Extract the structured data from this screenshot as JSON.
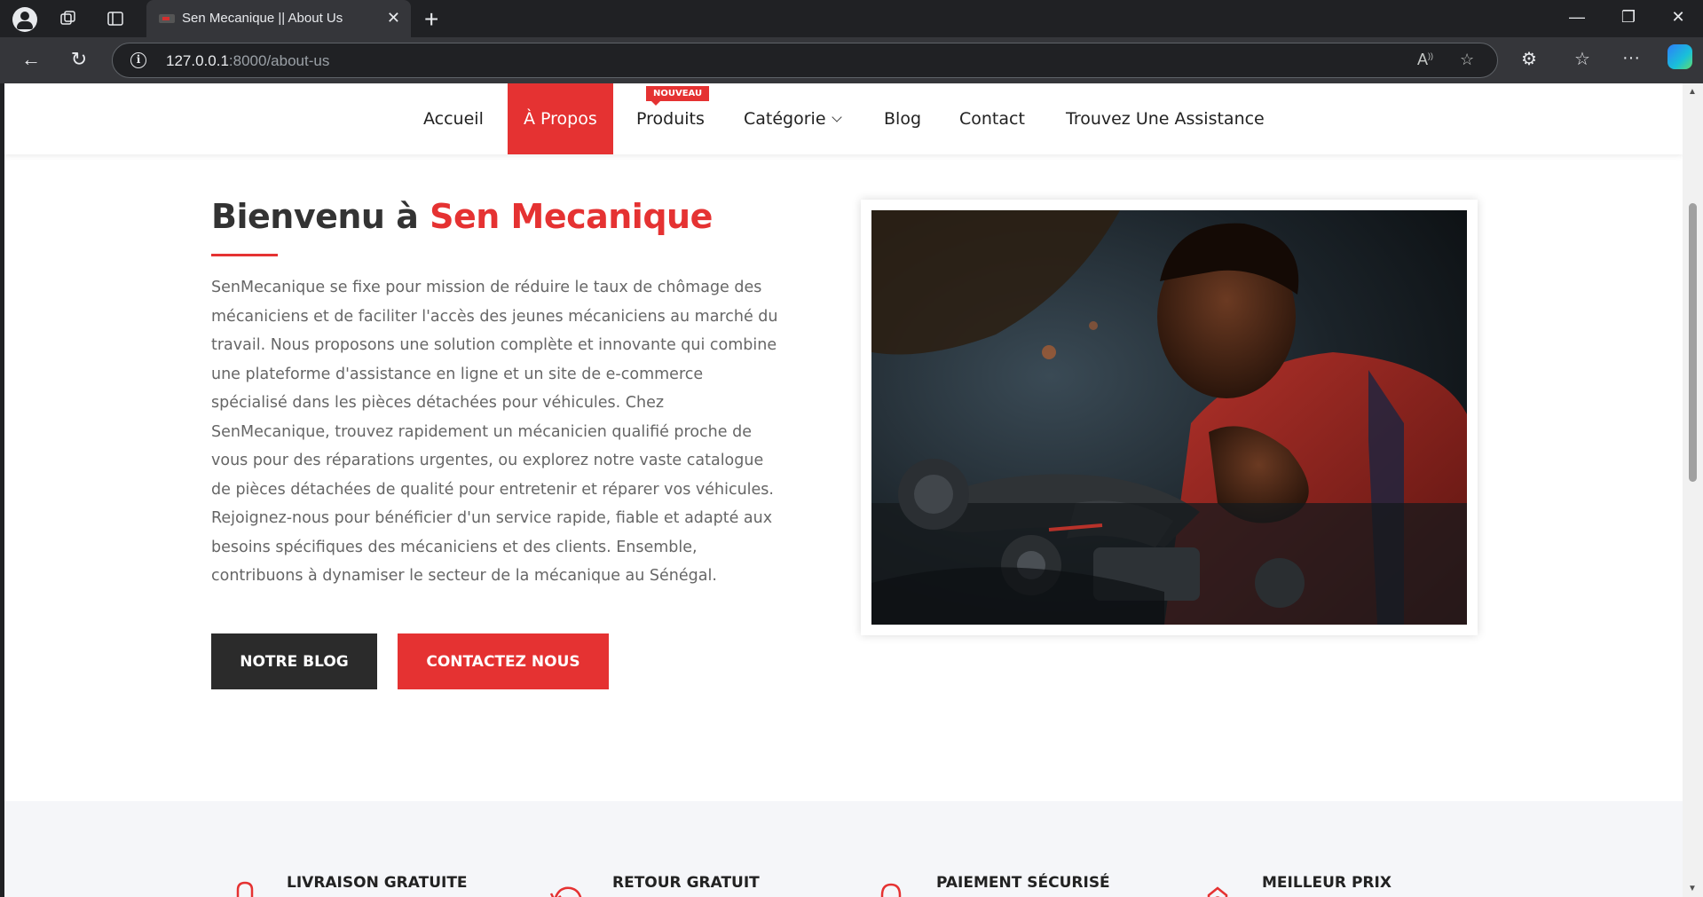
{
  "browser": {
    "tab_title": "Sen Mecanique || About Us",
    "url_host": "127.0.0.1",
    "url_path": ":8000/about-us"
  },
  "nav": {
    "items": [
      {
        "label": "Accueil"
      },
      {
        "label": "À Propos"
      },
      {
        "label": "Produits"
      },
      {
        "label": "Catégorie"
      },
      {
        "label": "Blog"
      },
      {
        "label": "Contact"
      },
      {
        "label": "Trouvez Une Assistance"
      }
    ],
    "active_index": 1,
    "badge": "NOUVEAU"
  },
  "about": {
    "title_prefix": "Bienvenu à ",
    "title_accent": "Sen Mecanique",
    "body": "SenMecanique se fixe pour mission de réduire le taux de chômage des mécaniciens et de faciliter l'accès des jeunes mécaniciens au marché du travail. Nous proposons une solution complète et innovante qui combine une plateforme d'assistance en ligne et un site de e-commerce spécialisé dans les pièces détachées pour véhicules. Chez SenMecanique, trouvez rapidement un mécanicien qualifié proche de vous pour des réparations urgentes, ou explorez notre vaste catalogue de pièces détachées de qualité pour entretenir et réparer vos véhicules. Rejoignez-nous pour bénéficier d'un service rapide, fiable et adapté aux besoins spécifiques des mécaniciens et des clients. Ensemble, contribuons à dynamiser le secteur de la mécanique au Sénégal.",
    "btn_blog": "NOTRE BLOG",
    "btn_contact": "CONTACTEZ NOUS"
  },
  "features": [
    {
      "title": "LIVRAISON GRATUITE",
      "icon": "truck-icon"
    },
    {
      "title": "RETOUR GRATUIT",
      "icon": "return-icon"
    },
    {
      "title": "PAIEMENT SÉCURISÉ",
      "icon": "lock-icon"
    },
    {
      "title": "MEILLEUR PRIX",
      "icon": "price-tag-icon"
    }
  ],
  "colors": {
    "accent": "#e53232",
    "dark": "#2b2b2b"
  }
}
